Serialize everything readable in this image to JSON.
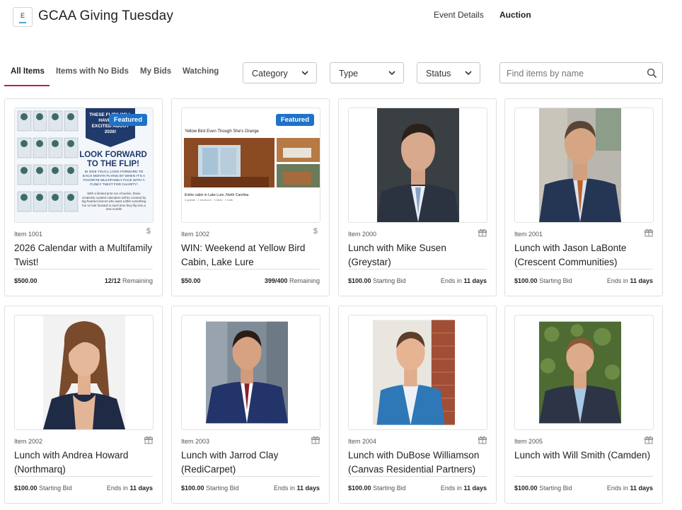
{
  "header": {
    "logo_letter": "E",
    "title": "GCAA Giving Tuesday",
    "nav": [
      {
        "label": "Event Details"
      },
      {
        "label": "Auction"
      }
    ]
  },
  "tabs": [
    {
      "label": "All Items"
    },
    {
      "label": "Items with No Bids"
    },
    {
      "label": "My Bids"
    },
    {
      "label": "Watching"
    }
  ],
  "filters": {
    "category": "Category",
    "type": "Type",
    "status": "Status"
  },
  "search": {
    "placeholder": "Find items by name"
  },
  "featured_label": "Featured",
  "remaining_label": "Remaining",
  "starting_bid_label": "Starting Bid",
  "ends_in_label": "Ends in",
  "items": [
    {
      "number": "Item 1001",
      "title": "2026 Calendar with a Multifamily Twist!",
      "price": "$500.00",
      "stock": "12/12",
      "type_icon": "dollar-icon",
      "calendar": {
        "banner": "THESE FLIPS WILL HAVE YOU EXCITED ABOUT 2026!",
        "headline": "LOOK FORWARD TO THE FLIP!",
        "body": "IN 2026 YOU'LL LOOK FORWARD TO EACH MONTH FLYING BY WHEN IT'S A FAVORITE MULTIFAMILY FACE WITH A FUNKY TWIST FOR CHARITY!",
        "note": "With a limited print run of twelve, these creatively curated calendars will be coveted by big-hearted donors who want a little something fun to look forward to each time they flip into a new month!"
      }
    },
    {
      "number": "Item 1002",
      "title": "WIN: Weekend at Yellow Bird Cabin, Lake Lure",
      "price": "$50.00",
      "stock": "399/400",
      "type_icon": "dollar-icon",
      "cabin": {
        "heading": "Yellow Bird Even Though She's Orange",
        "caption": "Entire cabin in Lake Lure, North Carolina",
        "details": "4 guests · 1 bedroom · 3 beds · 1 bath"
      }
    },
    {
      "number": "Item 2000",
      "title": "Lunch with Mike Susen (Greystar)",
      "price": "$100.00",
      "ends": "11 days",
      "type_icon": "gift-icon"
    },
    {
      "number": "Item 2001",
      "title": "Lunch with Jason LaBonte (Crescent Communities)",
      "price": "$100.00",
      "ends": "11 days",
      "type_icon": "gift-icon"
    },
    {
      "number": "Item 2002",
      "title": "Lunch with Andrea Howard (Northmarq)",
      "price": "$100.00",
      "ends": "11 days",
      "type_icon": "gift-icon"
    },
    {
      "number": "Item 2003",
      "title": "Lunch with Jarrod Clay (RediCarpet)",
      "price": "$100.00",
      "ends": "11 days",
      "type_icon": "gift-icon"
    },
    {
      "number": "Item 2004",
      "title": "Lunch with DuBose Williamson (Canvas Residential Partners)",
      "price": "$100.00",
      "ends": "11 days",
      "type_icon": "gift-icon"
    },
    {
      "number": "Item 2005",
      "title": "Lunch with Will Smith (Camden)",
      "price": "$100.00",
      "ends": "11 days",
      "type_icon": "gift-icon"
    }
  ],
  "colors": {
    "accent": "#c2185b",
    "featured": "#1e73c8"
  }
}
